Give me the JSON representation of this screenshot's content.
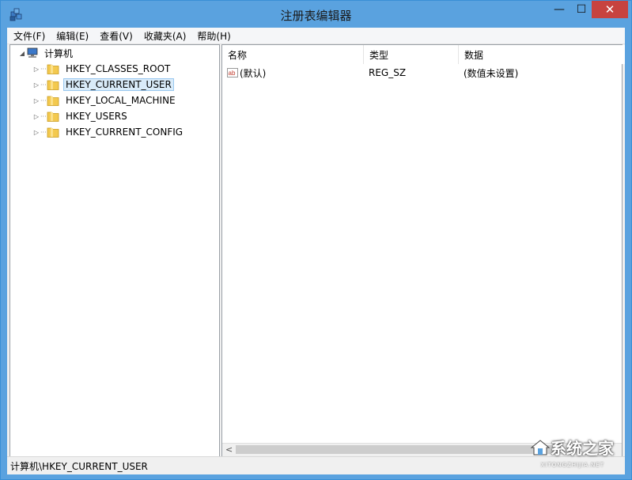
{
  "window": {
    "title": "注册表编辑器",
    "minimize": "—",
    "maximize": "☐",
    "close": "✕"
  },
  "menu": [
    "文件(F)",
    "编辑(E)",
    "查看(V)",
    "收藏夹(A)",
    "帮助(H)"
  ],
  "tree": {
    "root": "计算机",
    "keys": [
      "HKEY_CLASSES_ROOT",
      "HKEY_CURRENT_USER",
      "HKEY_LOCAL_MACHINE",
      "HKEY_USERS",
      "HKEY_CURRENT_CONFIG"
    ],
    "selected_index": 1
  },
  "list": {
    "columns": [
      "名称",
      "类型",
      "数据"
    ],
    "rows": [
      {
        "name": "(默认)",
        "type": "REG_SZ",
        "data": "(数值未设置)"
      }
    ]
  },
  "status": {
    "path": "计算机\\HKEY_CURRENT_USER"
  },
  "watermark": {
    "text": "系统之家",
    "sub": "XITONGZHIJIA.NET"
  },
  "colors": {
    "titlebar": "#5aa2df",
    "close": "#c7433f",
    "selection": "#d9ebf9"
  }
}
